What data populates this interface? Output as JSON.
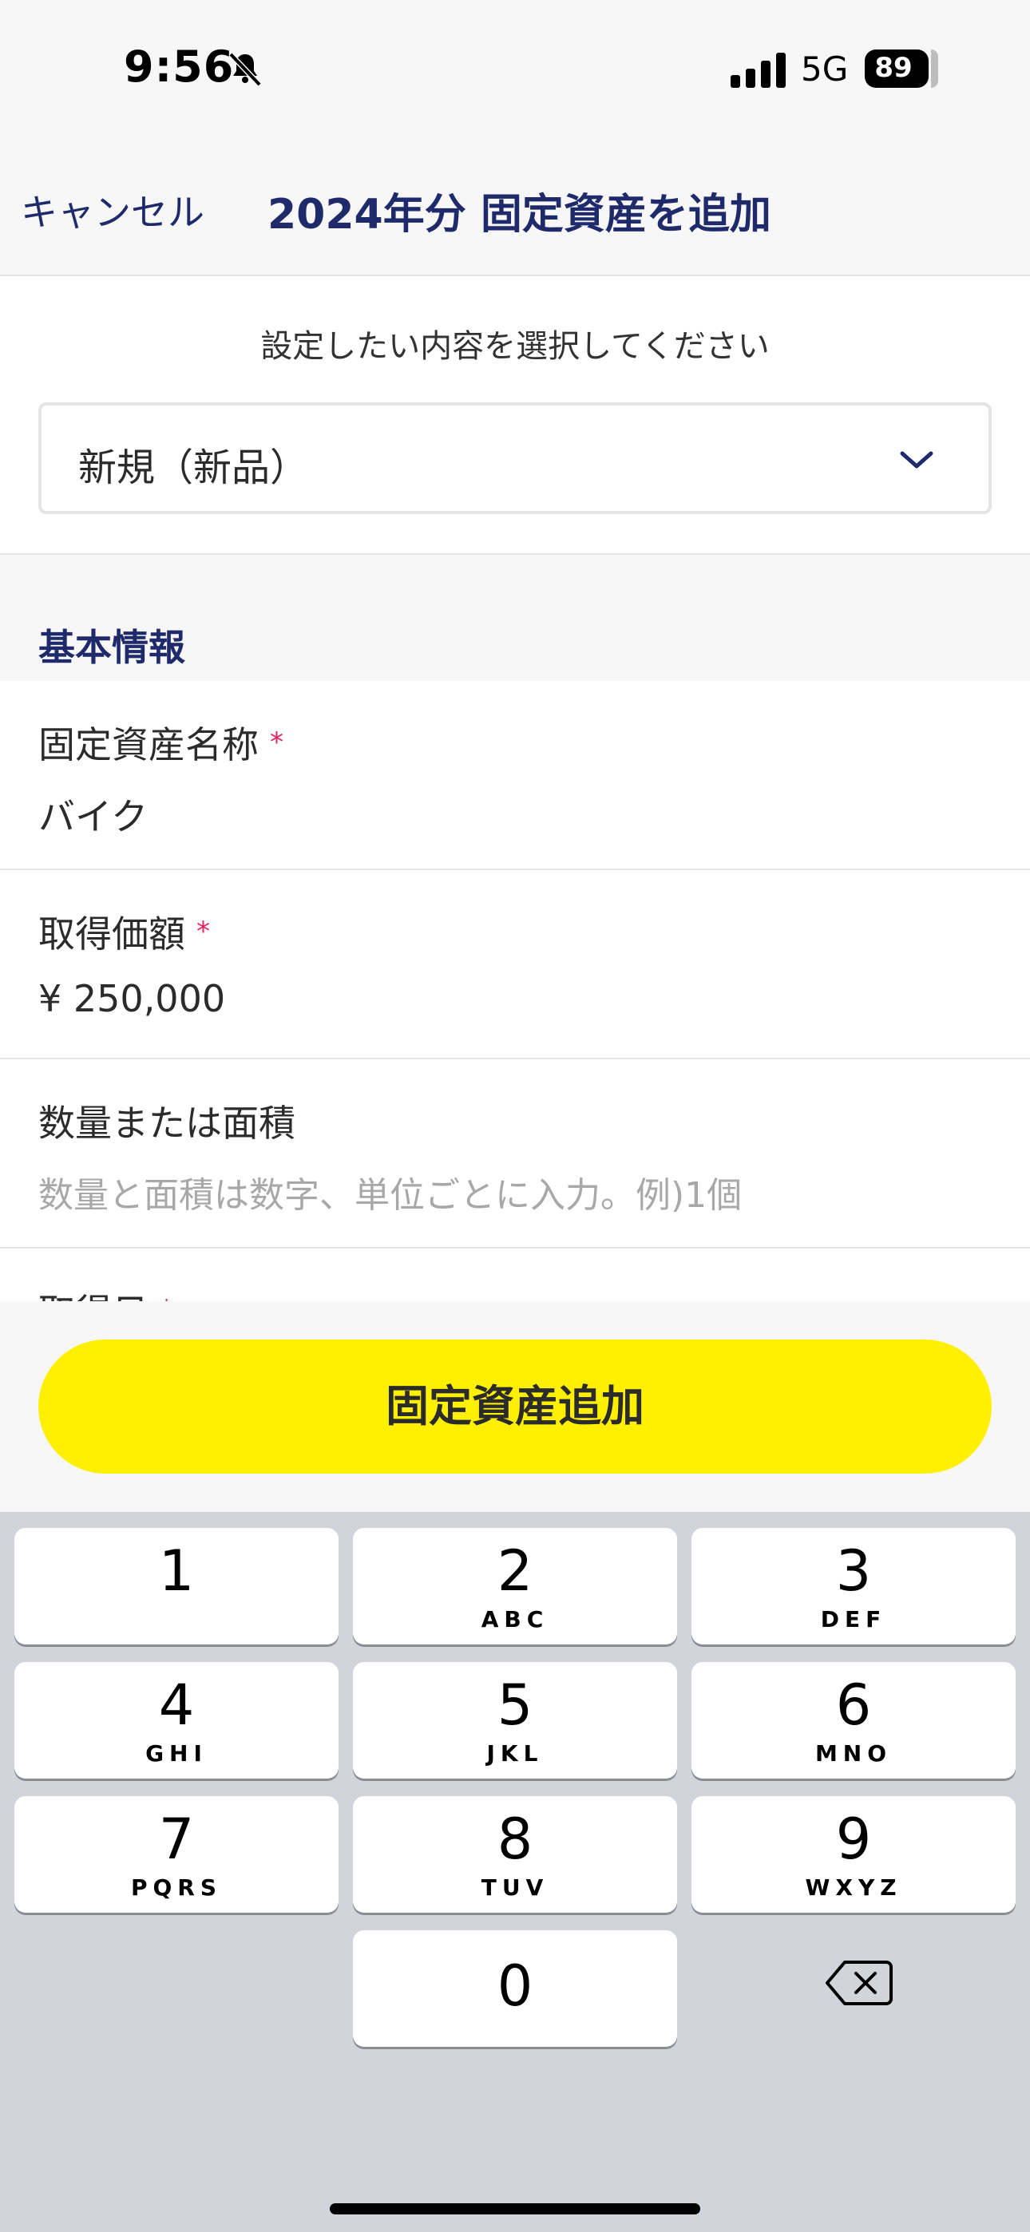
{
  "status_bar": {
    "time": "9:56",
    "network": "5G",
    "battery_level": "89"
  },
  "nav": {
    "cancel_label": "キャンセル",
    "title": "2024年分 固定資産を追加"
  },
  "selector": {
    "prompt": "設定したい内容を選択してください",
    "selected_value": "新規（新品）"
  },
  "section": {
    "title": "基本情報"
  },
  "form": {
    "fields": [
      {
        "label": "固定資産名称",
        "required_mark": "*",
        "value": "バイク"
      },
      {
        "label": "取得価額",
        "required_mark": "*",
        "value": "¥ 250,000"
      },
      {
        "label": "数量または面積",
        "placeholder": "数量と面積は数字、単位ごとに入力。例)1個"
      },
      {
        "label": "取得日",
        "required_mark": "*"
      }
    ]
  },
  "action": {
    "add_label": "固定資産追加",
    "color": "#fff000"
  },
  "keypad": {
    "keys": [
      {
        "digit": "1",
        "letters": ""
      },
      {
        "digit": "2",
        "letters": "ABC"
      },
      {
        "digit": "3",
        "letters": "DEF"
      },
      {
        "digit": "4",
        "letters": "GHI"
      },
      {
        "digit": "5",
        "letters": "JKL"
      },
      {
        "digit": "6",
        "letters": "MNO"
      },
      {
        "digit": "7",
        "letters": "PQRS"
      },
      {
        "digit": "8",
        "letters": "TUV"
      },
      {
        "digit": "9",
        "letters": "WXYZ"
      },
      {
        "digit": "0",
        "letters": ""
      }
    ],
    "backspace_icon": "delete-left-icon"
  },
  "colors": {
    "brand_navy": "#1f2a6b",
    "required_red": "#e0245e"
  }
}
